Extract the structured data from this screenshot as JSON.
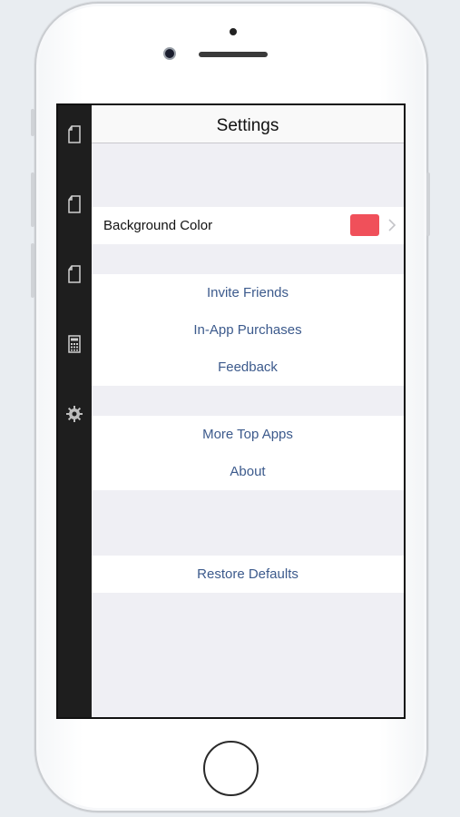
{
  "navbar": {
    "title": "Settings"
  },
  "sidebar": {
    "items": [
      {
        "icon": "document-icon"
      },
      {
        "icon": "document-icon"
      },
      {
        "icon": "document-icon"
      },
      {
        "icon": "calculator-icon"
      },
      {
        "icon": "gear-icon"
      }
    ]
  },
  "settings": {
    "background_color": {
      "label": "Background Color",
      "swatch": "#f0505a"
    },
    "group1": [
      "Invite Friends",
      "In-App Purchases",
      "Feedback"
    ],
    "group2": [
      "More Top Apps",
      "About"
    ],
    "group3": [
      "Restore Defaults"
    ]
  },
  "colors": {
    "link": "#3c5a8c",
    "sidebar": "#1e1e1e",
    "group_bg": "#efeff4"
  }
}
